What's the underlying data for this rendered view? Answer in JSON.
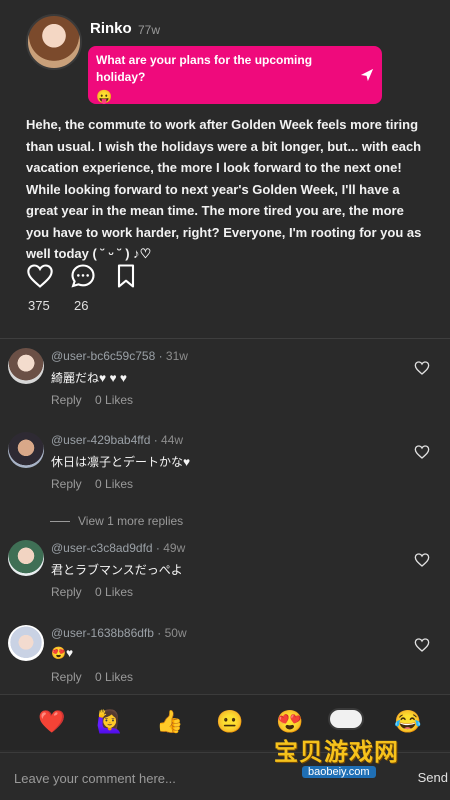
{
  "post": {
    "author": "Rinko",
    "time": "77w",
    "prompt": "What are your plans for the upcoming holiday?",
    "prompt_emoji": "😛",
    "body": "Hehe, the commute to work after Golden Week feels more tiring than usual. I wish the holidays were a bit longer, but... with each vacation experience, the more I look forward to the next one! While looking forward to next year's Golden Week, I'll have a great year in the mean time. The more tired you are, the more you have to work harder, right? Everyone, I'm rooting for you as well today ( ˘ ᵕ ˘ ) ♪♡",
    "likes": "375",
    "comments": "26",
    "accent": "#ef0a7c"
  },
  "comments": [
    {
      "user": "@user-bc6c59c758",
      "time": "31w",
      "text": "綺麗だね♥ ♥ ♥",
      "reply": "Reply",
      "likes": "0 Likes"
    },
    {
      "user": "@user-429bab4ffd",
      "time": "44w",
      "text": "休日は凛子とデートかな♥",
      "reply": "Reply",
      "likes": "0 Likes"
    },
    {
      "user": "@user-c3c8ad9dfd",
      "time": "49w",
      "text": "君とラブマンスだっぺよ",
      "reply": "Reply",
      "likes": "0 Likes"
    },
    {
      "user": "@user-1638b86dfb",
      "time": "50w",
      "text": "😍♥",
      "reply": "Reply",
      "likes": "0 Likes"
    }
  ],
  "more_replies": "View 1 more replies",
  "emoji_bar": [
    "❤️",
    "🙋‍♀️",
    "👍",
    "😐",
    "😍",
    "😂"
  ],
  "input": {
    "placeholder": "Leave your comment here...",
    "send_label": "Send"
  },
  "watermark": {
    "text": "宝贝游戏网",
    "url": "baobeiy.com"
  }
}
